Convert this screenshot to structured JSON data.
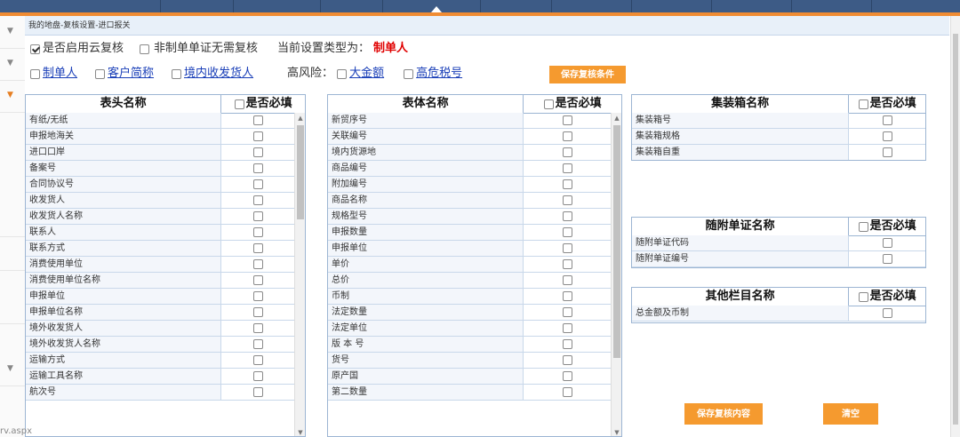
{
  "breadcrumb": "我的地盘-复核设置-进口报关",
  "options": {
    "enable_cloud": {
      "label": "是否启用云复核",
      "checked": true
    },
    "non_maker_skip": {
      "label": "非制单单证无需复核",
      "checked": false
    },
    "current_type_label": "当前设置类型为：",
    "current_type_value": "制单人",
    "type_links": [
      "制单人",
      "客户简称",
      "境内收发货人"
    ],
    "high_risk_label": "高风险：",
    "high_risk_links": [
      "大金额",
      "高危税号"
    ],
    "save_condition_button": "保存复核条件"
  },
  "header_table": {
    "name_header": "表头名称",
    "req_header": "是否必填",
    "rows": [
      "有纸/无纸",
      "申报地海关",
      "进口口岸",
      "备案号",
      "合同协议号",
      "收发货人",
      "收发货人名称",
      "联系人",
      "联系方式",
      "消费使用单位",
      "消费使用单位名称",
      "申报单位",
      "申报单位名称",
      "境外收发货人",
      "境外收发货人名称",
      "运输方式",
      "运输工具名称",
      "航次号"
    ]
  },
  "body_table": {
    "name_header": "表体名称",
    "req_header": "是否必填",
    "rows": [
      "新贸序号",
      "关联编号",
      "境内货源地",
      "商品编号",
      "附加编号",
      "商品名称",
      "规格型号",
      "申报数量",
      "申报单位",
      "单价",
      "总价",
      "币制",
      "法定数量",
      "法定单位",
      "版 本 号",
      "货号",
      "原产国",
      "第二数量"
    ]
  },
  "container_table": {
    "name_header": "集装箱名称",
    "req_header": "是否必填",
    "rows": [
      "集装箱号",
      "集装箱规格",
      "集装箱自重"
    ]
  },
  "document_table": {
    "name_header": "随附单证名称",
    "req_header": "是否必填",
    "rows": [
      "随附单证代码",
      "随附单证编号"
    ]
  },
  "other_table": {
    "name_header": "其他栏目名称",
    "req_header": "是否必填",
    "rows": [
      "总金额及币制"
    ]
  },
  "buttons": {
    "save_content": "保存复核内容",
    "clear": "清空"
  },
  "status_text": "rv.aspx",
  "colors": {
    "accent": "#f59a2f",
    "topbar": "#3d5b86",
    "link": "#1a3fb8",
    "highlight": "#e00000"
  }
}
